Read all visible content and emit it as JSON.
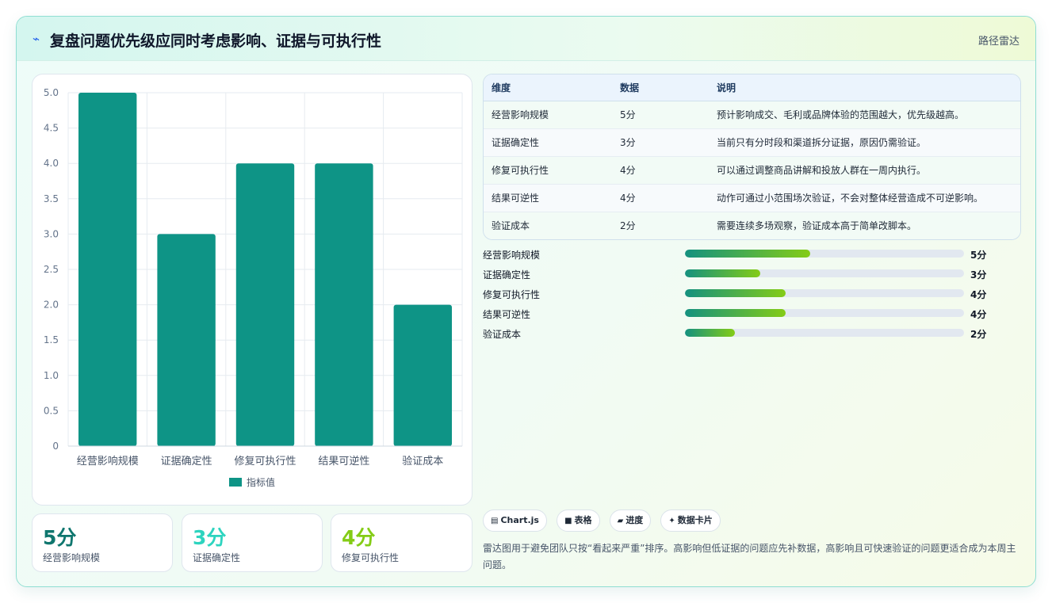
{
  "header": {
    "icon": "lightning-icon",
    "title": "复盘问题优先级应同时考虑影响、证据与可执行性",
    "tag": "路径雷达"
  },
  "chart_data": {
    "type": "bar",
    "categories": [
      "经营影响规模",
      "证据确定性",
      "修复可执行性",
      "结果可逆性",
      "验证成本"
    ],
    "series": [
      {
        "name": "指标值",
        "values": [
          5,
          3,
          4,
          4,
          2
        ],
        "color": "#0e9486"
      }
    ],
    "ylim": [
      0,
      5
    ],
    "yticks": [
      "0",
      "0.5",
      "1.0",
      "1.5",
      "2.0",
      "2.5",
      "3.0",
      "3.5",
      "4.0",
      "4.5",
      "5.0"
    ],
    "legend": "bottom",
    "grid": true
  },
  "stats": [
    {
      "value": "5分",
      "label": "经营影响规模",
      "color": "#0f766e"
    },
    {
      "value": "3分",
      "label": "证据确定性",
      "color": "#2dd4bf"
    },
    {
      "value": "4分",
      "label": "修复可执行性",
      "color": "#84cc16"
    }
  ],
  "table": {
    "headers": [
      "维度",
      "数据",
      "说明"
    ],
    "rows": [
      [
        "经营影响规模",
        "5分",
        "预计影响成交、毛利或品牌体验的范围越大，优先级越高。"
      ],
      [
        "证据确定性",
        "3分",
        "当前只有分时段和渠道拆分证据，原因仍需验证。"
      ],
      [
        "修复可执行性",
        "4分",
        "可以通过调整商品讲解和投放人群在一周内执行。"
      ],
      [
        "结果可逆性",
        "4分",
        "动作可通过小范围场次验证，不会对整体经营造成不可逆影响。"
      ],
      [
        "验证成本",
        "2分",
        "需要连续多场观察，验证成本高于简单改脚本。"
      ]
    ]
  },
  "progress": [
    {
      "label": "经营影响规模",
      "score": "5分",
      "fraction": 0.45
    },
    {
      "label": "证据确定性",
      "score": "3分",
      "fraction": 0.27
    },
    {
      "label": "修复可执行性",
      "score": "4分",
      "fraction": 0.36
    },
    {
      "label": "结果可逆性",
      "score": "4分",
      "fraction": 0.36
    },
    {
      "label": "验证成本",
      "score": "2分",
      "fraction": 0.18
    }
  ],
  "chips": [
    {
      "icon": "chart-icon",
      "glyph": "▤",
      "label": "Chart.js"
    },
    {
      "icon": "table-icon",
      "glyph": "■",
      "label": "表格"
    },
    {
      "icon": "progress-icon",
      "glyph": "▰",
      "label": "进度"
    },
    {
      "icon": "card-icon",
      "glyph": "✦",
      "label": "数据卡片"
    }
  ],
  "note": "雷达图用于避免团队只按“看起来严重”排序。高影响但低证据的问题应先补数据，高影响且可快速验证的问题更适合成为本周主问题。"
}
